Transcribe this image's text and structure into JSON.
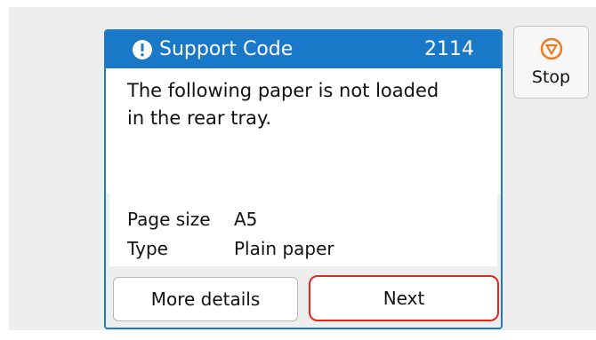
{
  "dialog": {
    "title": "Support Code",
    "code": "2114",
    "message_line1": "The following paper is not loaded",
    "message_line2": "in the rear tray.",
    "details": [
      {
        "key": "Page size",
        "value": "A5"
      },
      {
        "key": "Type",
        "value": "Plain paper"
      }
    ],
    "more_details_label": "More details",
    "next_label": "Next",
    "icon": "info-alert-icon"
  },
  "stop": {
    "label": "Stop",
    "icon": "stop-icon"
  },
  "colors": {
    "title_bar": "#1a78c8",
    "highlight": "#e02a1c",
    "stop_icon": "#f07a1e"
  }
}
